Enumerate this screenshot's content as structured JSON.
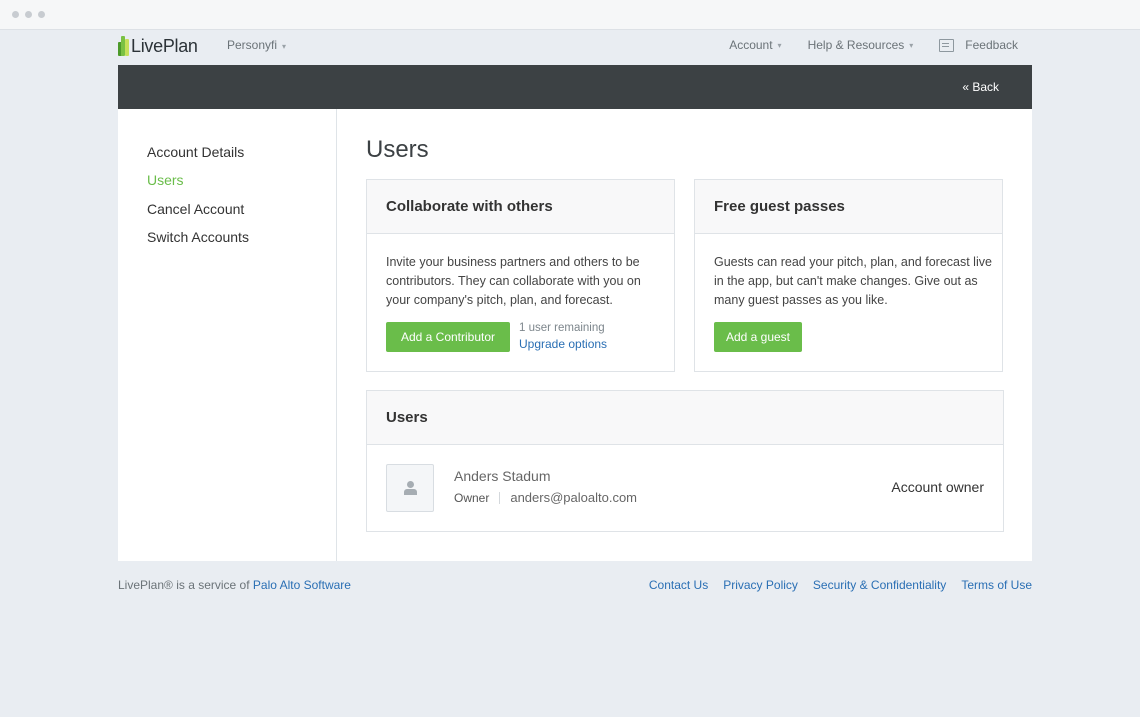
{
  "app": {
    "logo_text": "LivePlan",
    "company": "Personyfi"
  },
  "colors": {
    "accent_green": "#6abd4a",
    "dark_bar": "#3c4144",
    "link": "#2a6fb4",
    "logo_bars": [
      "#4c9a2a",
      "#7ac143",
      "#c5e05a"
    ]
  },
  "nav": {
    "account": "Account",
    "help": "Help & Resources",
    "feedback": "Feedback"
  },
  "header": {
    "back": "« Back"
  },
  "sidebar": {
    "items": [
      {
        "label": "Account Details",
        "active": false
      },
      {
        "label": "Users",
        "active": true
      },
      {
        "label": "Cancel Account",
        "active": false
      },
      {
        "label": "Switch Accounts",
        "active": false
      }
    ]
  },
  "main": {
    "title": "Users",
    "collaborate": {
      "heading": "Collaborate with others",
      "text": "Invite your business partners and others to be contributors. They can collaborate with you on your company's pitch, plan, and forecast.",
      "button": "Add a Contributor",
      "remaining": "1 user remaining",
      "upgrade": "Upgrade options"
    },
    "guests": {
      "heading": "Free guest passes",
      "text": "Guests can read your pitch, plan, and forecast live in the app, but can't make changes. Give out as many guest passes as you like.",
      "button": "Add a guest"
    },
    "users": {
      "heading": "Users",
      "list": [
        {
          "name": "Anders Stadum",
          "role_label": "Owner",
          "email": "anders@paloalto.com",
          "status": "Account owner"
        }
      ]
    }
  },
  "footer": {
    "prefix": "LivePlan® is a service of ",
    "company": "Palo Alto Software",
    "links": [
      "Contact Us",
      "Privacy Policy",
      "Security & Confidentiality",
      "Terms of Use"
    ]
  }
}
